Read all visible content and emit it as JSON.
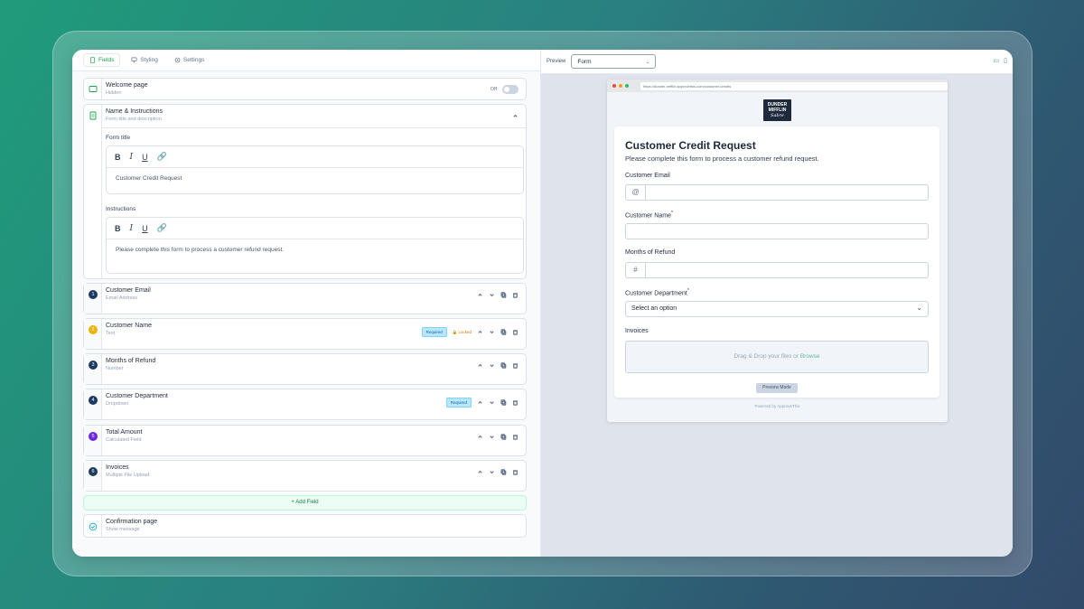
{
  "tabs": [
    "Fields",
    "Styling",
    "Settings"
  ],
  "welcome": {
    "title": "Welcome page",
    "subtitle": "Hidden",
    "toggle_label": "Off"
  },
  "instructions": {
    "title": "Name & Instructions",
    "subtitle": "Form title and description",
    "form_title_label": "Form title",
    "form_title_value": "Customer Credit Request",
    "instructions_label": "Instructions",
    "instructions_value": "Please complete this form to process a customer refund request."
  },
  "fields": [
    {
      "num": "1",
      "title": "Customer Email",
      "type": "Email Address",
      "required": "",
      "locked": "",
      "color": "#1e3a5f"
    },
    {
      "num": "2",
      "title": "Customer Name",
      "type": "Text",
      "required": "Required",
      "locked": "Locked",
      "color": "#eab308"
    },
    {
      "num": "3",
      "title": "Months of Refund",
      "type": "Number",
      "required": "",
      "locked": "",
      "color": "#1e3a5f"
    },
    {
      "num": "4",
      "title": "Customer Department",
      "type": "Dropdown",
      "required": "Required",
      "locked": "",
      "color": "#1e3a5f"
    },
    {
      "num": "5",
      "title": "Total Amount",
      "type": "Calculated Field",
      "required": "",
      "locked": "",
      "color": "#6d28d9"
    },
    {
      "num": "6",
      "title": "Invoices",
      "type": "Multiple File Upload",
      "required": "",
      "locked": "",
      "color": "#1e3a5f"
    }
  ],
  "add_field": "Add Field",
  "confirmation": {
    "title": "Confirmation page",
    "subtitle": "Show message"
  },
  "preview": {
    "label": "Preview",
    "mode": "Form",
    "url": "https://dunder-mifflin.approvethis.com/customer-credits",
    "logo_lines": [
      "DUNDER",
      "MIFFLIN",
      "Sabre"
    ]
  },
  "form": {
    "title": "Customer Credit Request",
    "description": "Please complete this form to process a customer refund request.",
    "email_label": "Customer Email",
    "email_prefix": "@",
    "name_label": "Customer Name",
    "months_label": "Months of Refund",
    "months_prefix": "#",
    "dept_label": "Customer Department",
    "dept_placeholder": "Select an option",
    "invoices_label": "Invoices",
    "drop_text": "Drag & Drop your files or ",
    "drop_link": "Browse",
    "preview_mode": "Preview Mode",
    "powered": "Powered by ApproveThis"
  },
  "required_mark": "*"
}
